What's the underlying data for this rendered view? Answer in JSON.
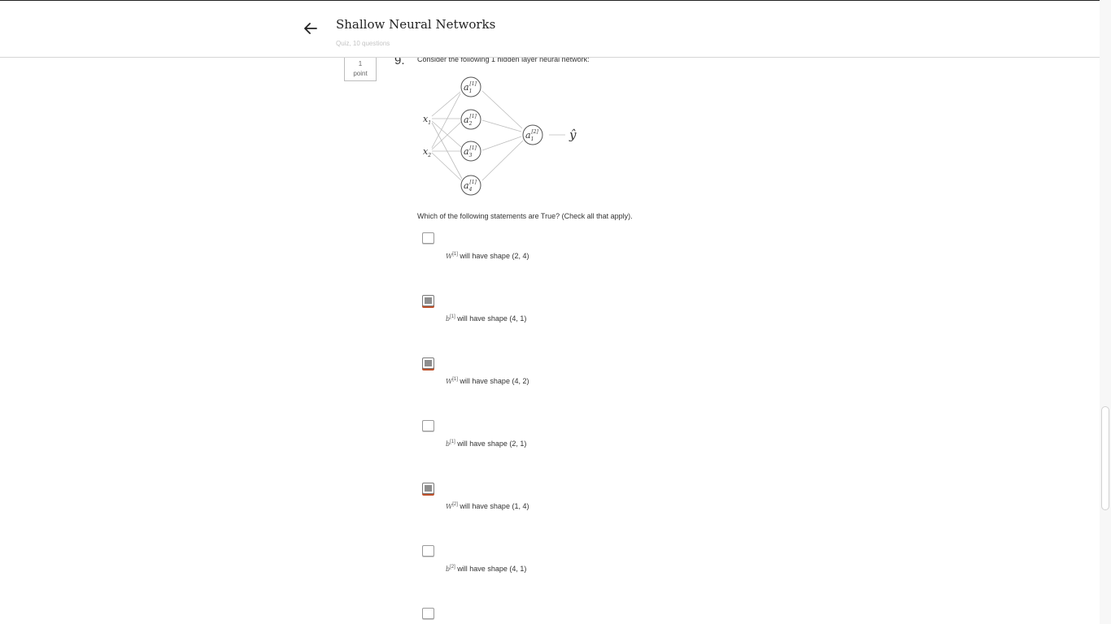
{
  "header": {
    "title": "Shallow Neural Networks",
    "subtitle": "Quiz, 10 questions",
    "back_icon": "arrow-left-icon"
  },
  "question": {
    "points_value": "1",
    "points_label": "point",
    "number": "9.",
    "text": "Consider the following 1 hidden layer neural network:",
    "prompt": "Which of the following statements are True? (Check all that apply).",
    "network": {
      "inputs": [
        "x1",
        "x2"
      ],
      "hidden": [
        "a1[1]",
        "a2[1]",
        "a3[1]",
        "a4[1]"
      ],
      "output_node": "a1[2]",
      "prediction": "ŷ"
    },
    "options": [
      {
        "sym": "W",
        "sup": "[1]",
        "text": " will have shape (2, 4)",
        "checked": false
      },
      {
        "sym": "b",
        "sup": "[1]",
        "text": " will have shape (4, 1)",
        "checked": true
      },
      {
        "sym": "W",
        "sup": "[1]",
        "text": " will have shape (4, 2)",
        "checked": true
      },
      {
        "sym": "b",
        "sup": "[1]",
        "text": " will have shape (2, 1)",
        "checked": false
      },
      {
        "sym": "W",
        "sup": "[2]",
        "text": " will have shape (1, 4)",
        "checked": true
      },
      {
        "sym": "b",
        "sup": "[2]",
        "text": " will have shape (4, 1)",
        "checked": false
      },
      {
        "sym": "",
        "sup": "",
        "text": "",
        "checked": false
      }
    ]
  },
  "colors": {
    "checked_accent": "#c0522c",
    "checked_fill": "#8e8e8e"
  }
}
